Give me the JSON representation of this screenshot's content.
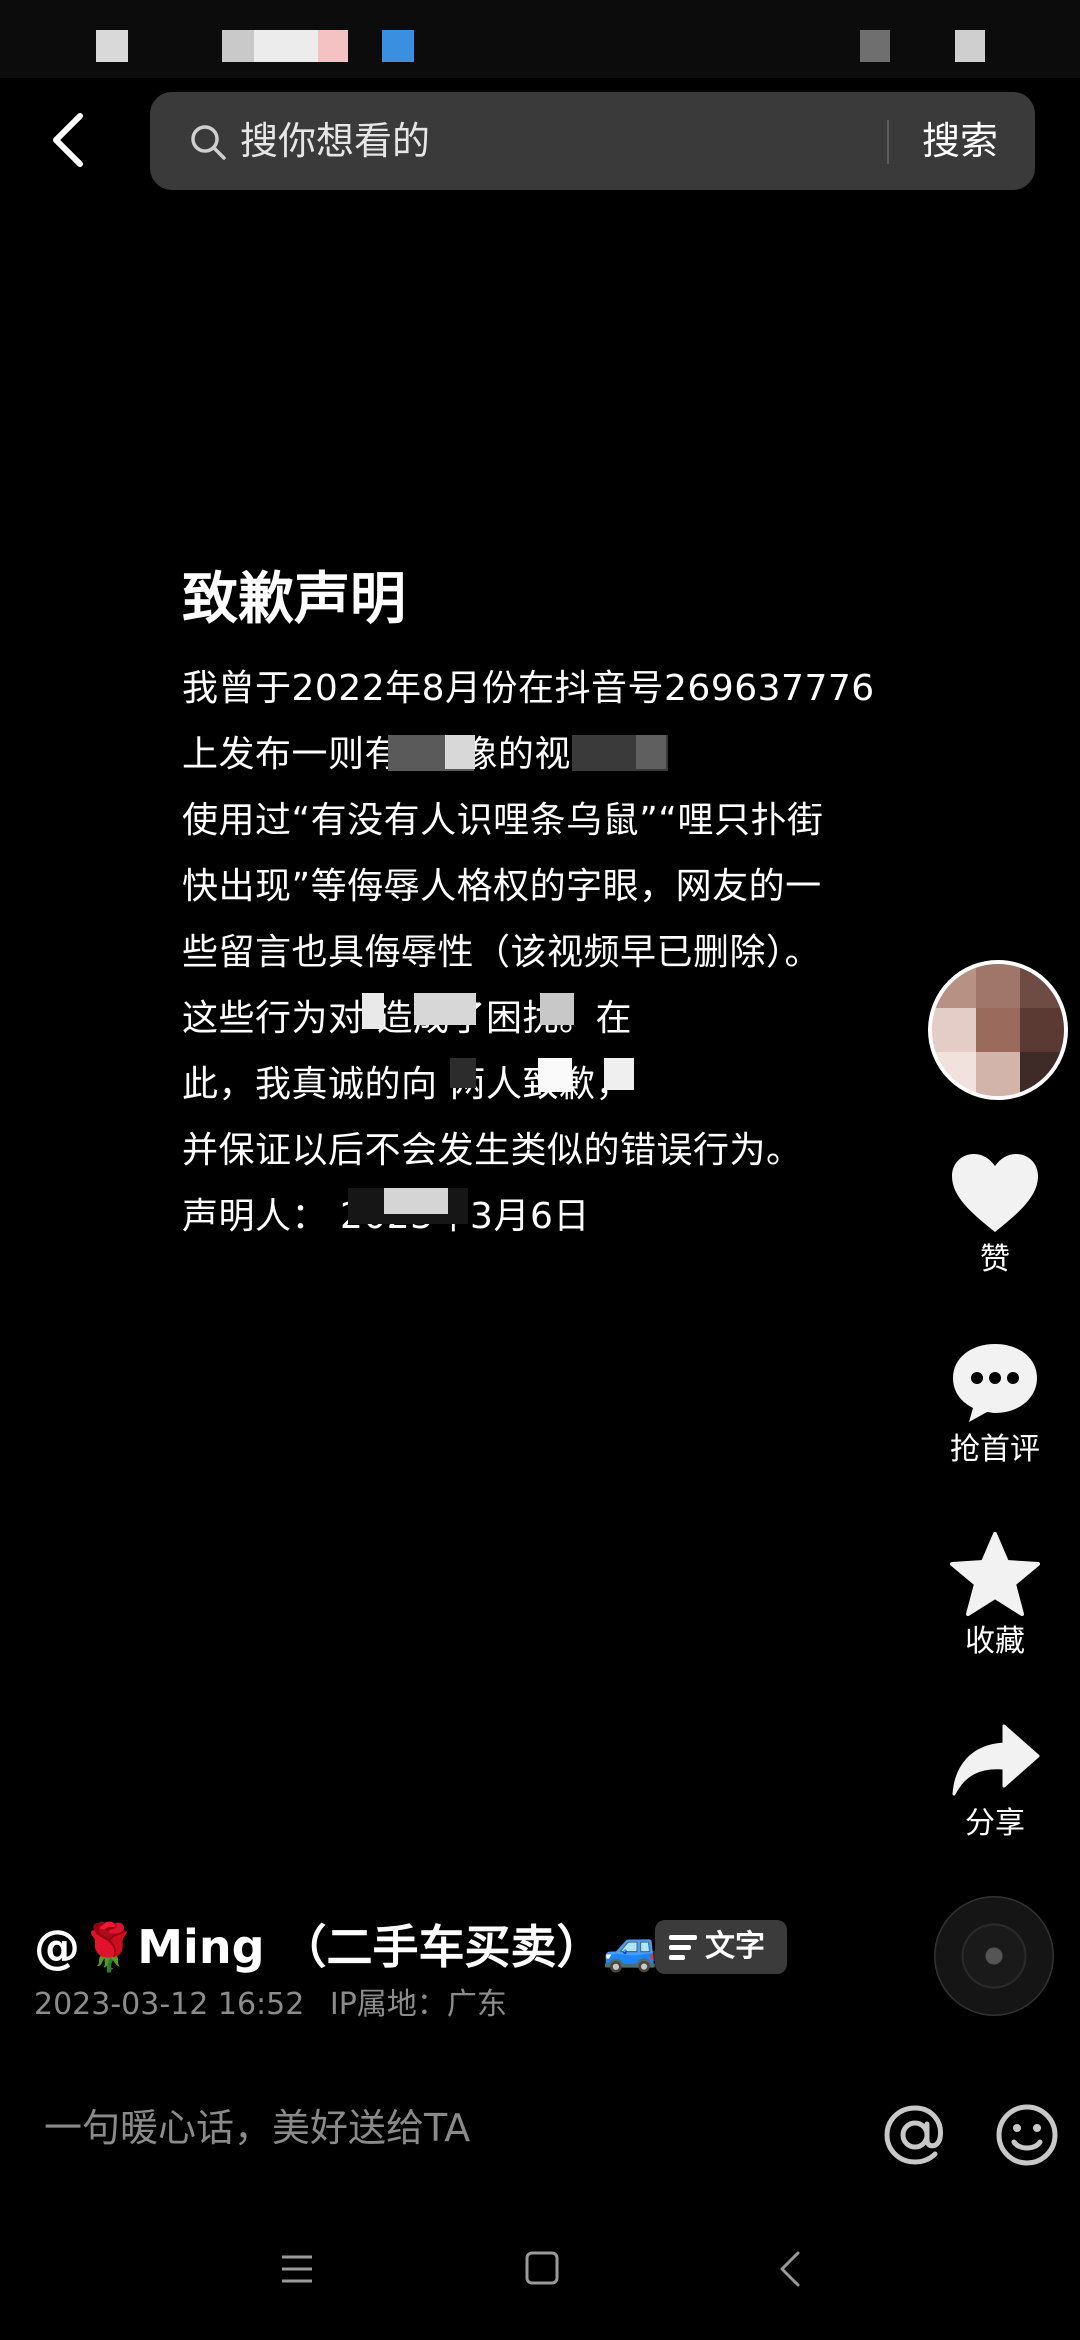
{
  "search": {
    "placeholder": "搜你想看的",
    "button_label": "搜索"
  },
  "document": {
    "title": "致歉声明",
    "lines": [
      "我曾于2022年8月份在抖音号269637776",
      "上发布一则有        ，        像的视频，",
      "使用过“有没有人识哩条乌鼠”“哩只扑街",
      "快出现”等侮辱人格权的字眼，网友的一",
      "些留言也具侮辱性（该视频早已删除）。",
      "这些行为对                        造成了困扰。在",
      "此，我真诚的向                     两人致歉，",
      "并保证以后不会发生类似的错误行为。",
      "声明人：            2023年3月6日"
    ]
  },
  "actions": {
    "like_label": "赞",
    "comment_label": "抢首评",
    "favorite_label": "收藏",
    "share_label": "分享"
  },
  "author": {
    "prefix": "@",
    "rose": "🌹",
    "name": "Ming （二手车买卖）",
    "car": "🚙",
    "tag_label": "文字"
  },
  "meta": {
    "datetime": "2023-03-12 16:52",
    "ip_location": "IP属地：广东"
  },
  "comment_bar": {
    "placeholder": "一句暖心话，美好送给TA"
  },
  "icons": {
    "back": "chevron-left-icon",
    "search": "search-icon",
    "like": "heart-icon",
    "comment": "chat-bubble-icon",
    "favorite": "star-icon",
    "share": "share-arrow-icon",
    "text_tag": "text-lines-icon",
    "mention": "at-icon",
    "emoji": "smiley-icon",
    "nav_menu": "menu-icon",
    "nav_home": "home-square-icon",
    "nav_back": "nav-back-icon"
  },
  "colors": {
    "background": "#000000",
    "search_bg": "#3a3a3a",
    "meta_text": "#8c8c8c"
  }
}
